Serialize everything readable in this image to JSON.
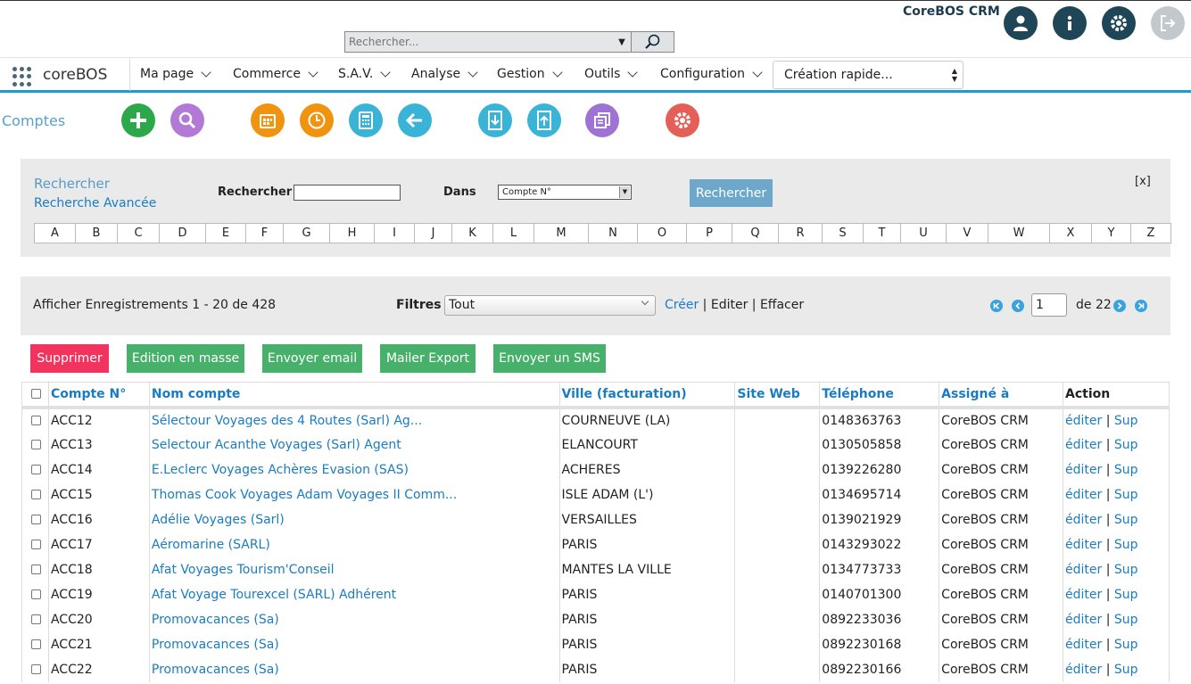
{
  "header": {
    "brand": "CoreBOS CRM",
    "search_placeholder": "Rechercher...",
    "icons": [
      "user-icon",
      "info-icon",
      "settings-icon",
      "logout-icon"
    ]
  },
  "nav": {
    "app_name": "coreBOS",
    "items": [
      "Ma page",
      "Commerce",
      "S.A.V.",
      "Analyse",
      "Gestion",
      "Outils",
      "Configuration"
    ],
    "quick_create": "Création rapide..."
  },
  "module": {
    "title": "Comptes",
    "toolbar_icons": [
      "add-icon",
      "search-icon",
      "calendar-icon",
      "clock-icon",
      "calculator-icon",
      "back-icon",
      "import-icon",
      "export-icon",
      "duplicates-icon",
      "settings-icon"
    ],
    "colors": {
      "green": "#2ca84a",
      "purple": "#b27ad6",
      "orange": "#f0930f",
      "teal": "#3ab4d6",
      "violet": "#9d73d4",
      "red": "#e45f58"
    }
  },
  "search": {
    "title": "Rechercher",
    "advanced_link": "Recherche Avancée",
    "label": "Rechercher",
    "value": "",
    "in_label": "Dans",
    "in_value": "Compte N°",
    "button": "Rechercher",
    "close": "[x]",
    "alphabet": [
      "A",
      "B",
      "C",
      "D",
      "E",
      "F",
      "G",
      "H",
      "I",
      "J",
      "K",
      "L",
      "M",
      "N",
      "O",
      "P",
      "Q",
      "R",
      "S",
      "T",
      "U",
      "V",
      "W",
      "X",
      "Y",
      "Z"
    ]
  },
  "listview": {
    "record_info": "Afficher Enregistrements 1 - 20 de 428",
    "filter_label": "Filtres :",
    "filter_value": "Tout",
    "filter_create": "Créer",
    "filter_edit": "Editer",
    "filter_delete": "Effacer",
    "page_value": "1",
    "page_total": "de 22"
  },
  "mass_actions": {
    "delete": "Supprimer",
    "mass_edit": "Edition en masse",
    "send_email": "Envoyer email",
    "mailer_export": "Mailer Export",
    "send_sms": "Envoyer un SMS"
  },
  "table": {
    "columns": [
      "Compte N°",
      "Nom compte",
      "Ville (facturation)",
      "Site Web",
      "Téléphone",
      "Assigné à",
      "Action"
    ],
    "action_edit": "éditer",
    "action_delete": "Sup",
    "rows": [
      {
        "no": "ACC12",
        "name": "Sélectour Voyages des 4 Routes (Sarl) Ag...",
        "city": "COURNEUVE (LA)",
        "web": "",
        "phone": "0148363763",
        "assigned": "CoreBOS CRM"
      },
      {
        "no": "ACC13",
        "name": "Selectour Acanthe Voyages (Sarl) Agent",
        "city": "ELANCOURT",
        "web": "",
        "phone": "0130505858",
        "assigned": "CoreBOS CRM"
      },
      {
        "no": "ACC14",
        "name": "E.Leclerc Voyages Achères Evasion (SAS)",
        "city": "ACHERES",
        "web": "",
        "phone": "0139226280",
        "assigned": "CoreBOS CRM"
      },
      {
        "no": "ACC15",
        "name": "Thomas Cook Voyages Adam Voyages II Comm...",
        "city": "ISLE ADAM (L')",
        "web": "",
        "phone": "0134695714",
        "assigned": "CoreBOS CRM"
      },
      {
        "no": "ACC16",
        "name": "Adélie Voyages (Sarl)",
        "city": "VERSAILLES",
        "web": "",
        "phone": "0139021929",
        "assigned": "CoreBOS CRM"
      },
      {
        "no": "ACC17",
        "name": "Aéromarine (SARL)",
        "city": "PARIS",
        "web": "",
        "phone": "0143293022",
        "assigned": "CoreBOS CRM"
      },
      {
        "no": "ACC18",
        "name": "Afat Voyages Tourism'Conseil",
        "city": "MANTES LA VILLE",
        "web": "",
        "phone": "0134773733",
        "assigned": "CoreBOS CRM"
      },
      {
        "no": "ACC19",
        "name": "Afat Voyage Tourexcel (SARL) Adhérent",
        "city": "PARIS",
        "web": "",
        "phone": "0140701300",
        "assigned": "CoreBOS CRM"
      },
      {
        "no": "ACC20",
        "name": "Promovacances (Sa)",
        "city": "PARIS",
        "web": "",
        "phone": "0892233036",
        "assigned": "CoreBOS CRM"
      },
      {
        "no": "ACC21",
        "name": "Promovacances (Sa)",
        "city": "PARIS",
        "web": "",
        "phone": "0892230168",
        "assigned": "CoreBOS CRM"
      },
      {
        "no": "ACC22",
        "name": "Promovacances (Sa)",
        "city": "PARIS",
        "web": "",
        "phone": "0892230166",
        "assigned": "CoreBOS CRM"
      }
    ]
  }
}
